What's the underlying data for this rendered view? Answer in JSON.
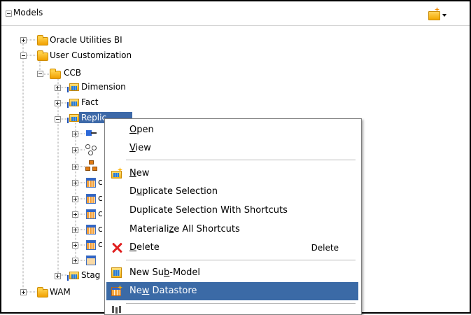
{
  "panel": {
    "title": "Models"
  },
  "tree": {
    "nodes": [
      {
        "label": "Oracle Utilities BI",
        "icon": "folder-icon",
        "expanded": false
      },
      {
        "label": "User Customization",
        "icon": "folder-icon",
        "expanded": true
      },
      {
        "label": "CCB",
        "icon": "folder-icon",
        "expanded": true
      },
      {
        "label": "Dimension",
        "icon": "submodel-icon",
        "expanded": false
      },
      {
        "label": "Fact",
        "icon": "submodel-icon",
        "expanded": false
      },
      {
        "label": "Replic",
        "icon": "submodel-icon",
        "expanded": true,
        "selected": true
      },
      {
        "label": "Stag",
        "icon": "submodel-icon",
        "expanded": false
      },
      {
        "label": "WAM",
        "icon": "folder-icon",
        "expanded": false
      }
    ],
    "replication_children": [
      {
        "icon": "key-icon",
        "label": ""
      },
      {
        "icon": "graph-icon",
        "label": ""
      },
      {
        "icon": "hierarchy-icon",
        "label": ""
      },
      {
        "icon": "datastore-icon",
        "label": "c"
      },
      {
        "icon": "datastore-icon",
        "label": "c"
      },
      {
        "icon": "datastore-icon",
        "label": "c"
      },
      {
        "icon": "datastore-icon",
        "label": "c"
      },
      {
        "icon": "datastore-icon",
        "label": "c"
      },
      {
        "icon": "datastore-icon",
        "label": ""
      }
    ]
  },
  "context_menu": {
    "items": [
      {
        "label": "Open",
        "mnemonic": "O",
        "rest": "pen"
      },
      {
        "label": "View",
        "mnemonic": "V",
        "rest": "iew"
      },
      {
        "label": "New",
        "mnemonic": "N",
        "rest": "ew",
        "icon": "new-model-icon"
      },
      {
        "label": "Duplicate Selection",
        "pre": "D",
        "mnemonic": "u",
        "rest": "plicate Selection"
      },
      {
        "label": "Duplicate Selection With Shortcuts"
      },
      {
        "label": "Materialize All Shortcuts",
        "pre": "Materiali",
        "mnemonic": "z",
        "rest": "e All Shortcuts"
      },
      {
        "label": "Delete",
        "mnemonic": "D",
        "rest": "elete",
        "shortcut": "Delete",
        "icon": "delete-icon"
      },
      {
        "label": "New Sub-Model",
        "pre": "New Su",
        "mnemonic": "b",
        "rest": "-Model",
        "icon": "submodel-icon"
      },
      {
        "label": "New Datastore",
        "pre": "Ne",
        "mnemonic": "w",
        "rest": " Datastore",
        "icon": "datastore-icon",
        "highlighted": true
      },
      {
        "label": "",
        "icon": "misc-icon"
      }
    ]
  },
  "colors": {
    "selection": "#3d69a8",
    "menu_highlight": "#3b6aa6",
    "folder": "#f0a000"
  }
}
